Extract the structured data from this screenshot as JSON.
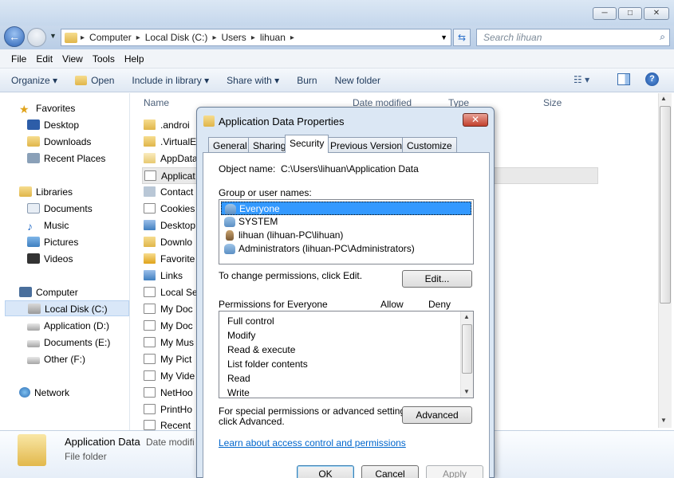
{
  "window": {
    "min_glyph": "─",
    "max_glyph": "□",
    "close_glyph": "✕"
  },
  "nav": {
    "back_glyph": "←",
    "breadcrumbs": [
      "Computer",
      "Local Disk (C:)",
      "Users",
      "lihuan"
    ],
    "search_placeholder": "Search lihuan"
  },
  "menu": [
    "File",
    "Edit",
    "View",
    "Tools",
    "Help"
  ],
  "toolbar": {
    "organize": "Organize ▾",
    "open": "Open",
    "include": "Include in library ▾",
    "share": "Share with ▾",
    "burn": "Burn",
    "new_folder": "New folder"
  },
  "sidebar": {
    "favorites": "Favorites",
    "fav_items": [
      "Desktop",
      "Downloads",
      "Recent Places"
    ],
    "libraries": "Libraries",
    "lib_items": [
      "Documents",
      "Music",
      "Pictures",
      "Videos"
    ],
    "computer": "Computer",
    "drives": [
      "Local Disk (C:)",
      "Application (D:)",
      "Documents (E:)",
      "Other (F:)"
    ],
    "network": "Network"
  },
  "columns": {
    "name": "Name",
    "date": "Date modified",
    "type": "Type",
    "size": "Size"
  },
  "files": [
    ".androi",
    ".VirtualE",
    "AppData",
    "Applicat",
    "Contact",
    "Cookies",
    "Desktop",
    "Downlo",
    "Favorite",
    "Links",
    "Local Se",
    "My Doc",
    "My Doc",
    "My Mus",
    "My Pict",
    "My Vide",
    "NetHoo",
    "PrintHo",
    "Recent"
  ],
  "details": {
    "name": "Application Data",
    "date_label": "Date modifi",
    "type": "File folder"
  },
  "dialog": {
    "title": "Application Data Properties",
    "tabs": [
      "General",
      "Sharing",
      "Security",
      "Previous Versions",
      "Customize"
    ],
    "object_label": "Object name:",
    "object_value": "C:\\Users\\lihuan\\Application Data",
    "group_label": "Group or user names:",
    "users": [
      "Everyone",
      "SYSTEM",
      "lihuan (lihuan-PC\\lihuan)",
      "Administrators (lihuan-PC\\Administrators)"
    ],
    "change_text": "To change permissions, click Edit.",
    "edit_button": "Edit...",
    "perm_label": "Permissions for Everyone",
    "allow": "Allow",
    "deny": "Deny",
    "permissions": [
      "Full control",
      "Modify",
      "Read & execute",
      "List folder contents",
      "Read",
      "Write"
    ],
    "special_line1": "For special permissions or advanced settings,",
    "special_line2": "click Advanced.",
    "advanced_button": "Advanced",
    "learn_link": "Learn about access control and permissions",
    "ok": "OK",
    "cancel": "Cancel",
    "apply": "Apply"
  }
}
